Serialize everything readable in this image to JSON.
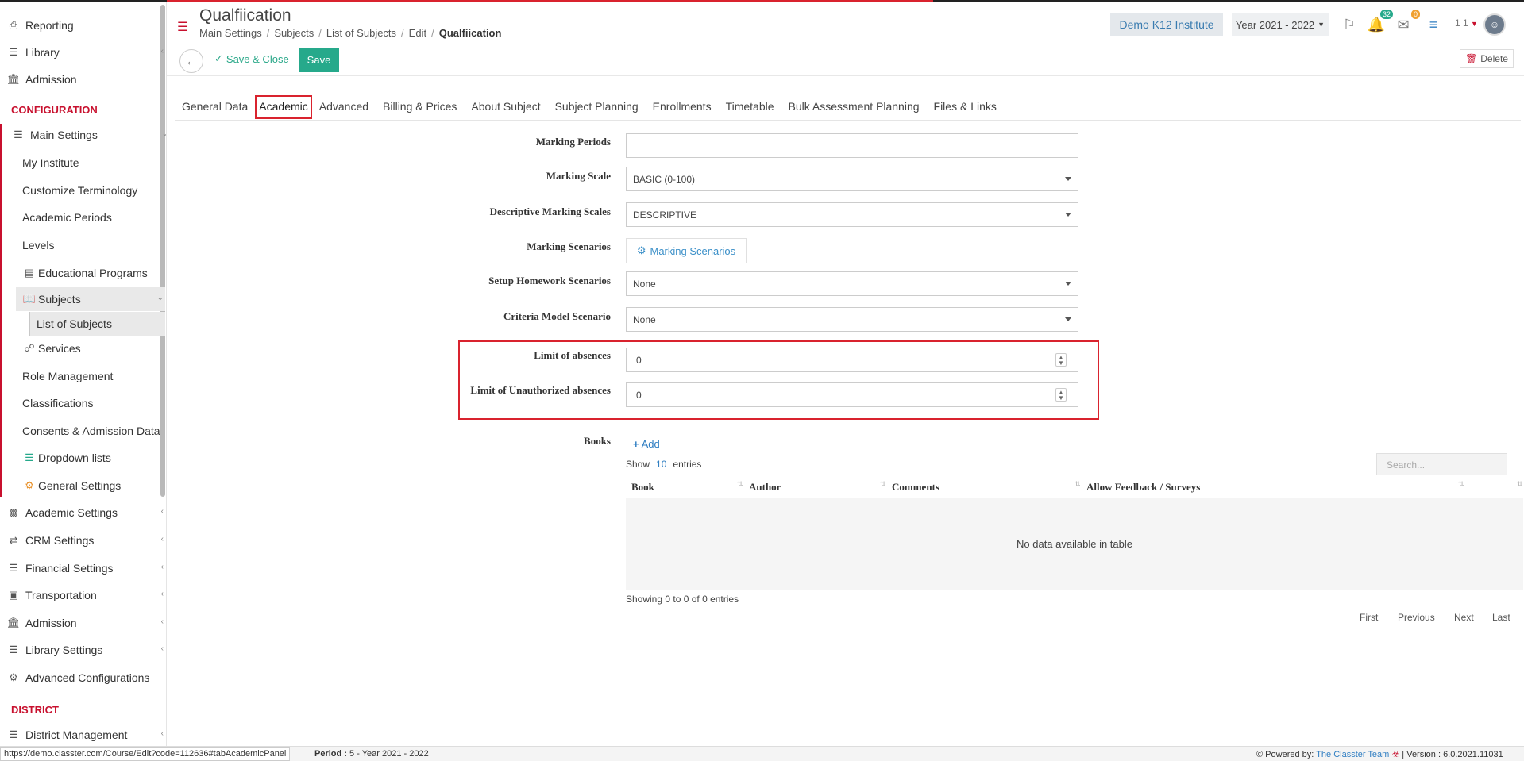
{
  "sidebar": {
    "top_items": [
      {
        "label": "Reporting",
        "icon": "print-icon"
      },
      {
        "label": "Library",
        "icon": "books-icon"
      },
      {
        "label": "Admission",
        "icon": "institution-icon"
      }
    ],
    "section_configuration": "CONFIGURATION",
    "main_settings": "Main Settings",
    "sub_items": [
      "My Institute",
      "Customize Terminology",
      "Academic Periods",
      "Levels",
      "Educational Programs",
      "Subjects",
      "List of Subjects",
      "Services",
      "Role Management",
      "Classifications",
      "Consents & Admission Data",
      "Dropdown lists",
      "General Settings"
    ],
    "bottom_items": [
      "Academic Settings",
      "CRM Settings",
      "Financial Settings",
      "Transportation",
      "Admission",
      "Library Settings",
      "Advanced Configurations"
    ],
    "section_district": "DISTRICT",
    "district_item": "District Management"
  },
  "header": {
    "title": "Qualfiication",
    "breadcrumb": [
      "Main Settings",
      "Subjects",
      "List of Subjects",
      "Edit",
      "Qualfiication"
    ],
    "institute": "Demo K12 Institute",
    "year": "Year 2021 - 2022",
    "notif_count": "32",
    "mail_count": "0",
    "user_short": "1 1"
  },
  "toolbar": {
    "save_close": "Save & Close",
    "save": "Save",
    "delete": "Delete"
  },
  "tabs": [
    "General Data",
    "Academic",
    "Advanced",
    "Billing & Prices",
    "About Subject",
    "Subject Planning",
    "Enrollments",
    "Timetable",
    "Bulk Assessment Planning",
    "Files & Links"
  ],
  "form": {
    "marking_periods": {
      "label": "Marking Periods",
      "value": ""
    },
    "marking_scale": {
      "label": "Marking Scale",
      "value": "BASIC (0-100)"
    },
    "descriptive_scales": {
      "label": "Descriptive Marking Scales",
      "value": "DESCRIPTIVE"
    },
    "marking_scenarios": {
      "label": "Marking Scenarios",
      "button": "Marking Scenarios"
    },
    "homework_scenarios": {
      "label": "Setup Homework Scenarios",
      "value": "None"
    },
    "criteria_model": {
      "label": "Criteria Model Scenario",
      "value": "None"
    },
    "limit_absences": {
      "label": "Limit of absences",
      "value": "0"
    },
    "limit_unauth": {
      "label": "Limit of Unauthorized absences",
      "value": "0"
    }
  },
  "books": {
    "label": "Books",
    "add": "Add",
    "show": "Show",
    "show_count": "10",
    "entries": "entries",
    "search_placeholder": "Search...",
    "columns": [
      "Book",
      "Author",
      "Comments",
      "Allow Feedback / Surveys"
    ],
    "empty": "No data available in table",
    "showing": "Showing 0 to 0 of 0 entries",
    "pager": [
      "First",
      "Previous",
      "Next",
      "Last"
    ]
  },
  "status": {
    "url": "https://demo.classter.com/Course/Edit?code=112636#tabAcademicPanel",
    "period_label": "Period :",
    "period_value": "5 - Year 2021 - 2022",
    "powered_by": "Powered by:",
    "team": "The Classter Team",
    "version": "| Version : 6.0.2021.11031"
  },
  "colors": {
    "accent_red": "#c8102e",
    "save_green": "#26a98b",
    "link_blue": "#2f7ec2"
  }
}
